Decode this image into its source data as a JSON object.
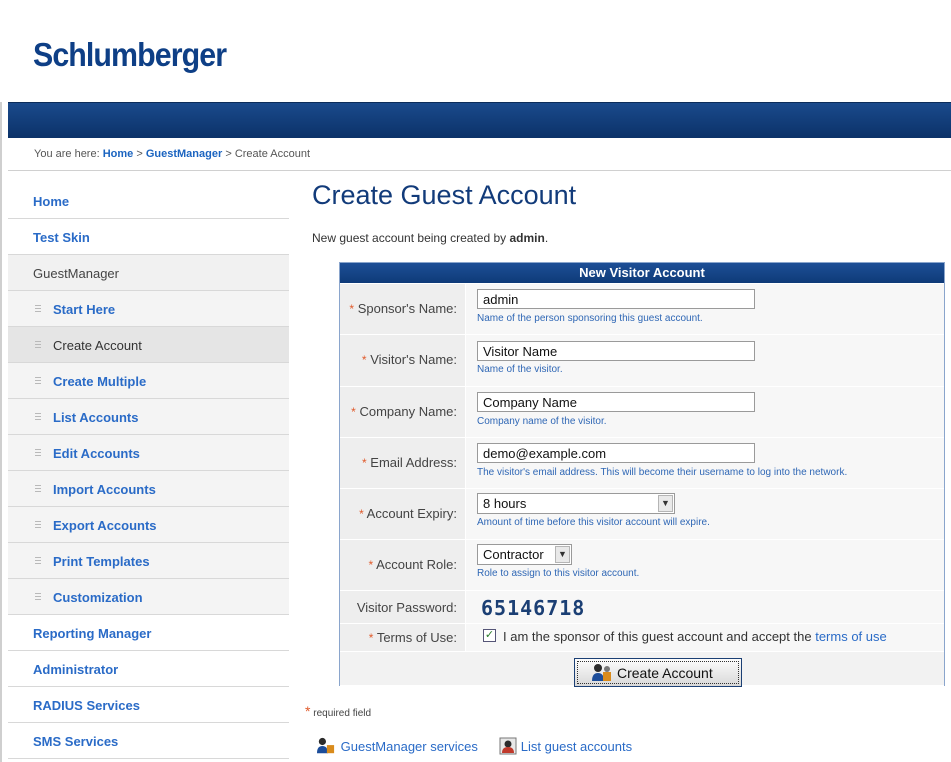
{
  "brand": {
    "logo_text": "Schlumberger",
    "color": "#0e3f86"
  },
  "breadcrumb": {
    "prefix": "You are here:",
    "items": [
      "Home",
      "GuestManager",
      "Create Account"
    ],
    "sep": ">"
  },
  "sidebar": {
    "items": [
      {
        "label": "Home"
      },
      {
        "label": "Test Skin"
      },
      {
        "label": "GuestManager"
      },
      {
        "label": "Start Here"
      },
      {
        "label": "Create Account"
      },
      {
        "label": "Create Multiple"
      },
      {
        "label": "List Accounts"
      },
      {
        "label": "Edit Accounts"
      },
      {
        "label": "Import Accounts"
      },
      {
        "label": "Export Accounts"
      },
      {
        "label": "Print Templates"
      },
      {
        "label": "Customization"
      },
      {
        "label": "Reporting Manager"
      },
      {
        "label": "Administrator"
      },
      {
        "label": "RADIUS Services"
      },
      {
        "label": "SMS Services"
      }
    ]
  },
  "page": {
    "title": "Create Guest Account",
    "subtitle_prefix": "New guest account being created by",
    "subtitle_user": "admin",
    "subtitle_suffix": "."
  },
  "form": {
    "heading": "New Visitor Account",
    "required_mark": "*",
    "sponsor": {
      "label": "Sponsor's Name:",
      "value": "admin",
      "hint": "Name of the person sponsoring this guest account."
    },
    "visitor": {
      "label": "Visitor's Name:",
      "value": "Visitor Name",
      "hint": "Name of the visitor."
    },
    "company": {
      "label": "Company Name:",
      "value": "Company Name",
      "hint": "Company name of the visitor."
    },
    "email": {
      "label": "Email Address:",
      "value": "demo@example.com",
      "hint": "The visitor's email address. This will become their username to log into the network."
    },
    "expiry": {
      "label": "Account Expiry:",
      "value": "8 hours",
      "hint": "Amount of time before this visitor account will expire."
    },
    "role": {
      "label": "Account Role:",
      "value": "Contractor",
      "hint": "Role to assign to this visitor account."
    },
    "password": {
      "label": "Visitor Password:",
      "value": "65146718"
    },
    "terms": {
      "label": "Terms of Use:",
      "checked": true,
      "text": "I am the sponsor of this guest account and accept the",
      "link": "terms of use"
    },
    "submit": "Create Account"
  },
  "required_note": "required field",
  "footer_links": [
    "GuestManager services",
    "List guest accounts"
  ]
}
